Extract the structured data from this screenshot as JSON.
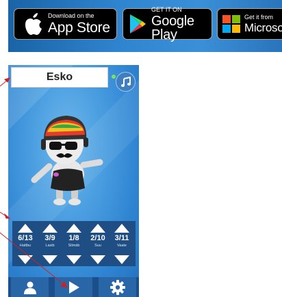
{
  "store_badges": {
    "apple": {
      "small": "Download on the",
      "big": "App Store"
    },
    "google": {
      "small": "GET IT ON",
      "big": "Google Play"
    },
    "microsoft": {
      "small": "Get it from",
      "big": "Microsoft"
    }
  },
  "app": {
    "character_name": "Esko",
    "music_icon": "music-note-icon",
    "slots": [
      {
        "count": "6/13",
        "label": "Hattbu"
      },
      {
        "count": "3/9",
        "label": "Lasib"
      },
      {
        "count": "1/8",
        "label": "Silmäb"
      },
      {
        "count": "2/10",
        "label": "Suu"
      },
      {
        "count": "3/11",
        "label": "Vaate"
      }
    ],
    "bottom_bar": {
      "profile_icon": "person-icon",
      "play_icon": "play-icon",
      "settings_icon": "gear-icon"
    }
  },
  "colors": {
    "background_blue": "#3a90d8",
    "panel_blue": "#1f4e84",
    "button_blue": "#2866a8",
    "annotation_arrow": "#cc2222",
    "online_dot": "#7be35a"
  }
}
